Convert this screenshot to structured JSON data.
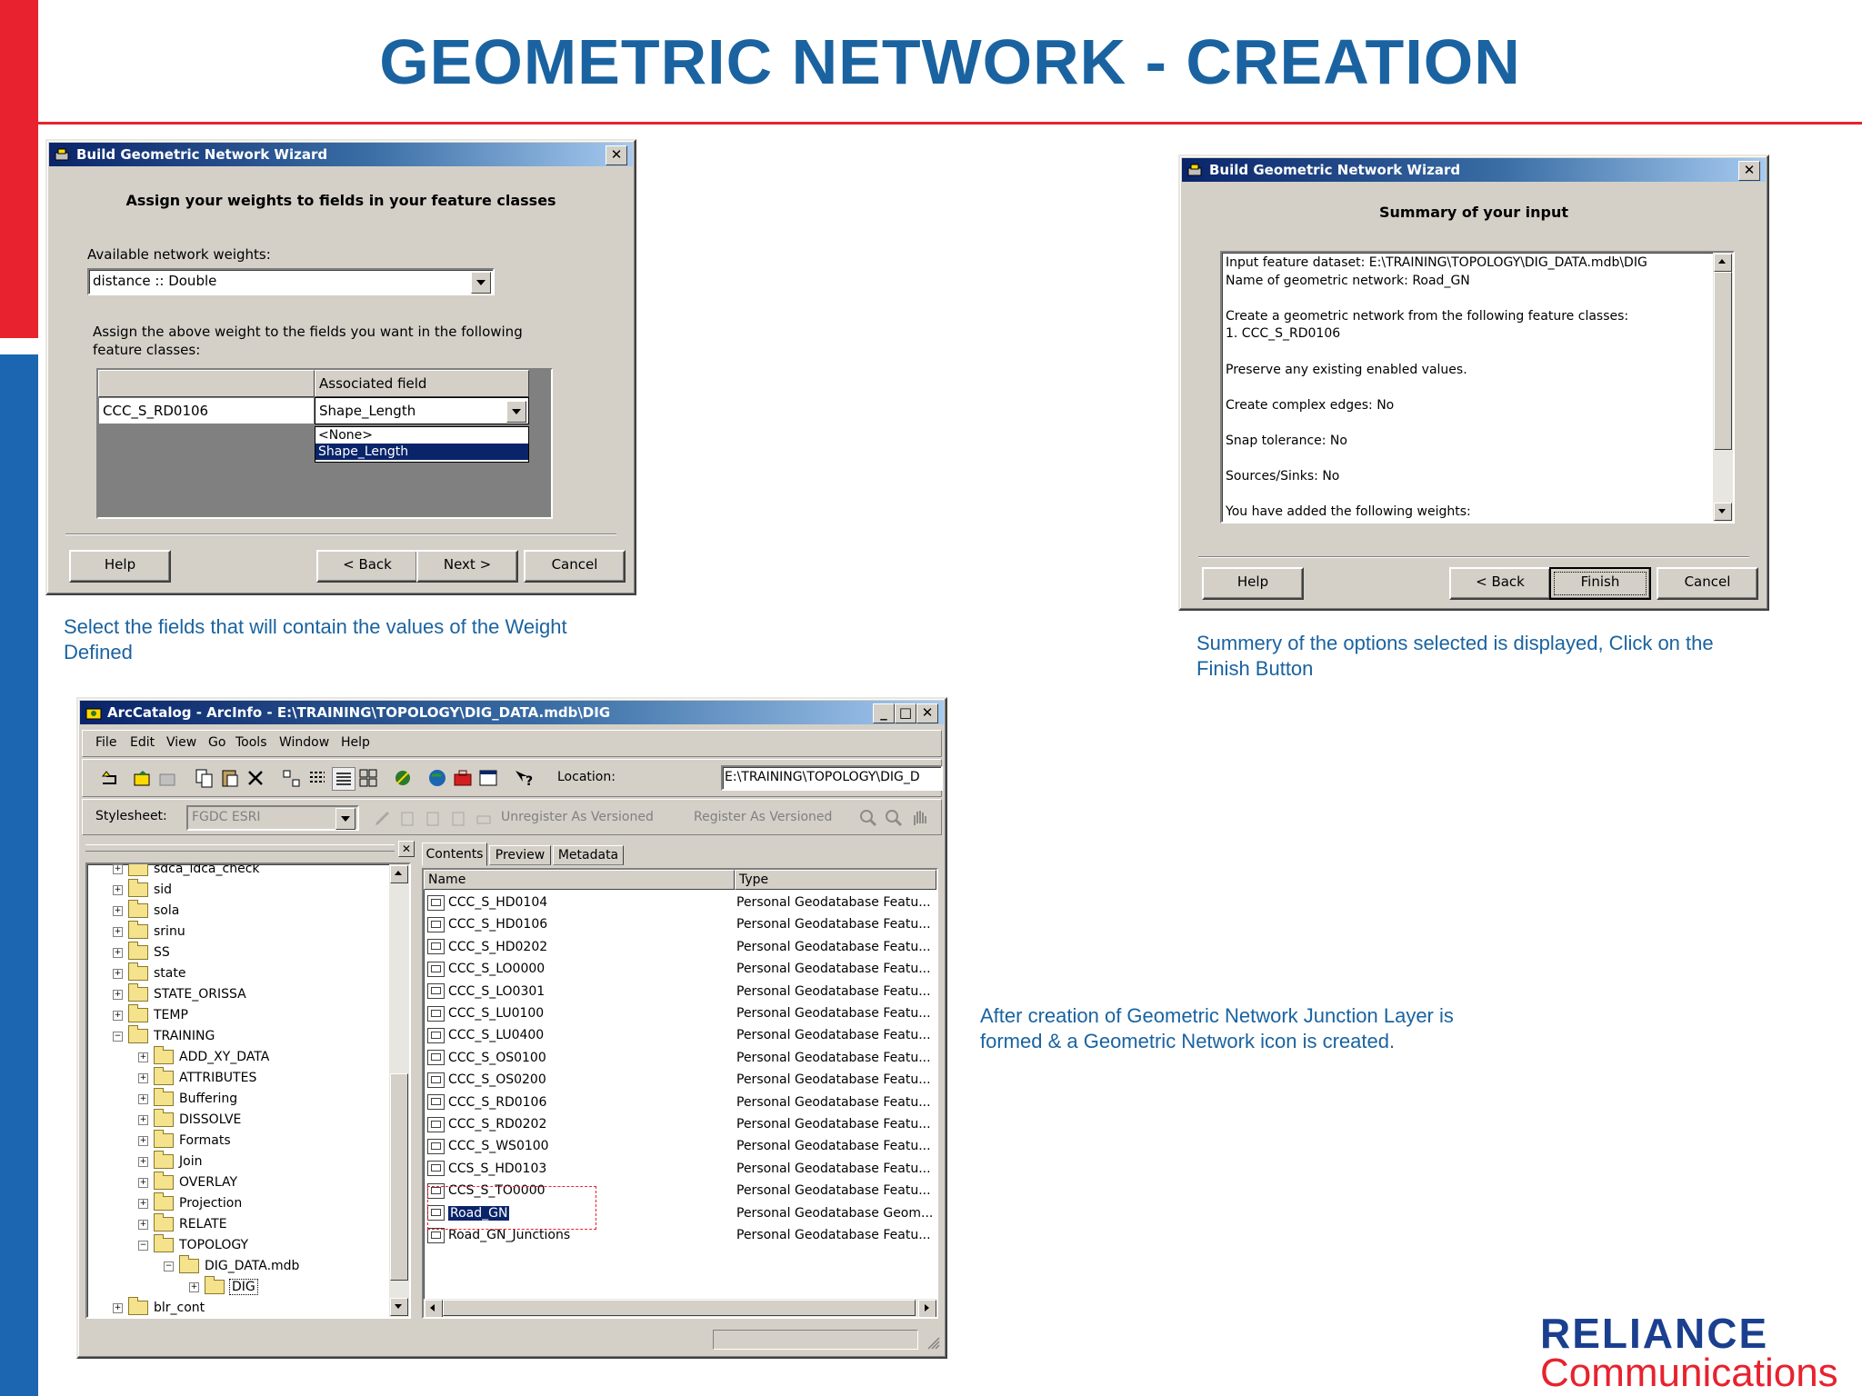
{
  "slide": {
    "title": "GEOMETRIC NETWORK - CREATION",
    "caption_1": "Select the fields that will contain the values of the Weight Defined",
    "caption_2": "Summery of the options selected is displayed, Click on the Finish Button",
    "caption_3": "After creation of Geometric Network Junction Layer is formed & a Geometric Network icon is created.",
    "logo_line1": "RELIANCE",
    "logo_line2": "Communications",
    "colors": {
      "title": "#1a63a0",
      "accent_red": "#e8222e",
      "accent_blue": "#1c66b1"
    }
  },
  "wizard_weights": {
    "title": "Build Geometric Network Wizard",
    "close_glyph": "✕",
    "heading": "Assign your weights to fields in your feature classes",
    "available_label": "Available network weights:",
    "available_value": "distance :: Double",
    "assign_text": "Assign the above weight to the fields you want in the following feature classes:",
    "col_associated": "Associated field",
    "row_class": "CCC_S_RD0106",
    "row_field": "Shape_Length",
    "dropdown_options": [
      "<None>",
      "Shape_Length"
    ],
    "buttons": {
      "help": "Help",
      "back": "< Back",
      "next": "Next >",
      "cancel": "Cancel"
    }
  },
  "wizard_summary": {
    "title": "Build Geometric Network Wizard",
    "close_glyph": "✕",
    "heading": "Summary of your input",
    "lines": [
      "Input feature dataset: E:\\TRAINING\\TOPOLOGY\\DIG_DATA.mdb\\DIG",
      "Name of geometric network: Road_GN",
      "",
      "Create a geometric network from the following feature classes:",
      "1. CCC_S_RD0106",
      "",
      "Preserve any existing enabled values.",
      "",
      "Create complex edges: No",
      "",
      "Snap tolerance: No",
      "",
      "Sources/Sinks: No",
      "",
      "You have added the following weights:"
    ],
    "buttons": {
      "help": "Help",
      "back": "< Back",
      "finish": "Finish",
      "cancel": "Cancel"
    }
  },
  "arccatalog": {
    "title": "ArcCatalog - ArcInfo - E:\\TRAINING\\TOPOLOGY\\DIG_DATA.mdb\\DIG",
    "window_glyphs": {
      "minimize": "_",
      "maximize": "□",
      "close": "✕"
    },
    "menu": [
      "File",
      "Edit",
      "View",
      "Go",
      "Tools",
      "Window",
      "Help"
    ],
    "location_label": "Location:",
    "location_value": "E:\\TRAINING\\TOPOLOGY\\DIG_D",
    "stylesheet_label": "Stylesheet:",
    "stylesheet_value": "FGDC ESRI",
    "unregister_label": "Unregister As Versioned",
    "register_label": "Register As Versioned",
    "tabs": [
      "Contents",
      "Preview",
      "Metadata"
    ],
    "tree_close_glyph": "✕",
    "tree": [
      {
        "label": "sdca_ldca_check",
        "level": 1,
        "pm": "+"
      },
      {
        "label": "sid",
        "level": 1,
        "pm": "+"
      },
      {
        "label": "sola",
        "level": 1,
        "pm": "+"
      },
      {
        "label": "srinu",
        "level": 1,
        "pm": "+"
      },
      {
        "label": "SS",
        "level": 1,
        "pm": "+"
      },
      {
        "label": "state",
        "level": 1,
        "pm": "+"
      },
      {
        "label": "STATE_ORISSA",
        "level": 1,
        "pm": "+"
      },
      {
        "label": "TEMP",
        "level": 1,
        "pm": "+"
      },
      {
        "label": "TRAINING",
        "level": 1,
        "pm": "−"
      },
      {
        "label": "ADD_XY_DATA",
        "level": 2,
        "pm": "+"
      },
      {
        "label": "ATTRIBUTES",
        "level": 2,
        "pm": "+"
      },
      {
        "label": "Buffering",
        "level": 2,
        "pm": "+"
      },
      {
        "label": "DISSOLVE",
        "level": 2,
        "pm": "+"
      },
      {
        "label": "Formats",
        "level": 2,
        "pm": "+"
      },
      {
        "label": "Join",
        "level": 2,
        "pm": "+"
      },
      {
        "label": "OVERLAY",
        "level": 2,
        "pm": "+"
      },
      {
        "label": "Projection",
        "level": 2,
        "pm": "+"
      },
      {
        "label": "RELATE",
        "level": 2,
        "pm": "+"
      },
      {
        "label": "TOPOLOGY",
        "level": 2,
        "pm": "−"
      },
      {
        "label": "DIG_DATA.mdb",
        "level": 3,
        "pm": "−"
      },
      {
        "label": "DIG",
        "level": 4,
        "pm": "+"
      },
      {
        "label": "blr_cont",
        "level": 1,
        "pm": "+"
      }
    ],
    "list_headers": {
      "name": "Name",
      "type": "Type"
    },
    "list": [
      {
        "name": "CCC_S_HD0104",
        "type": "Personal Geodatabase Featu..."
      },
      {
        "name": "CCC_S_HD0106",
        "type": "Personal Geodatabase Featu..."
      },
      {
        "name": "CCC_S_HD0202",
        "type": "Personal Geodatabase Featu..."
      },
      {
        "name": "CCC_S_LO0000",
        "type": "Personal Geodatabase Featu..."
      },
      {
        "name": "CCC_S_LO0301",
        "type": "Personal Geodatabase Featu..."
      },
      {
        "name": "CCC_S_LU0100",
        "type": "Personal Geodatabase Featu..."
      },
      {
        "name": "CCC_S_LU0400",
        "type": "Personal Geodatabase Featu..."
      },
      {
        "name": "CCC_S_OS0100",
        "type": "Personal Geodatabase Featu..."
      },
      {
        "name": "CCC_S_OS0200",
        "type": "Personal Geodatabase Featu..."
      },
      {
        "name": "CCC_S_RD0106",
        "type": "Personal Geodatabase Featu..."
      },
      {
        "name": "CCC_S_RD0202",
        "type": "Personal Geodatabase Featu..."
      },
      {
        "name": "CCC_S_WS0100",
        "type": "Personal Geodatabase Featu..."
      },
      {
        "name": "CCS_S_HD0103",
        "type": "Personal Geodatabase Featu..."
      },
      {
        "name": "CCS_S_TO0000",
        "type": "Personal Geodatabase Featu..."
      },
      {
        "name": "Road_GN",
        "type": "Personal Geodatabase Geom..."
      },
      {
        "name": "Road_GN_Junctions",
        "type": "Personal Geodatabase Featu..."
      }
    ]
  }
}
